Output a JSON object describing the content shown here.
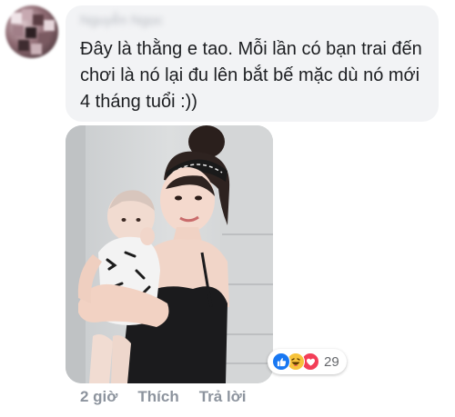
{
  "comment": {
    "author_name": "Nguyễn Ngọc",
    "text": "Đây là thằng e tao. Mỗi lần có bạn trai đến chơi là nó lại đu lên bắt bế mặc dù nó mới 4 tháng tuổi :))",
    "photo_icon": "photo-woman-holding-baby"
  },
  "reactions": {
    "icons": [
      "like-icon",
      "haha-icon",
      "love-icon"
    ],
    "count": "29",
    "colors": {
      "like": "#1877f2",
      "haha": "#f7c33b",
      "love": "#f33e58"
    }
  },
  "actions": {
    "timestamp": "2 giờ",
    "like_label": "Thích",
    "reply_label": "Trả lời"
  }
}
